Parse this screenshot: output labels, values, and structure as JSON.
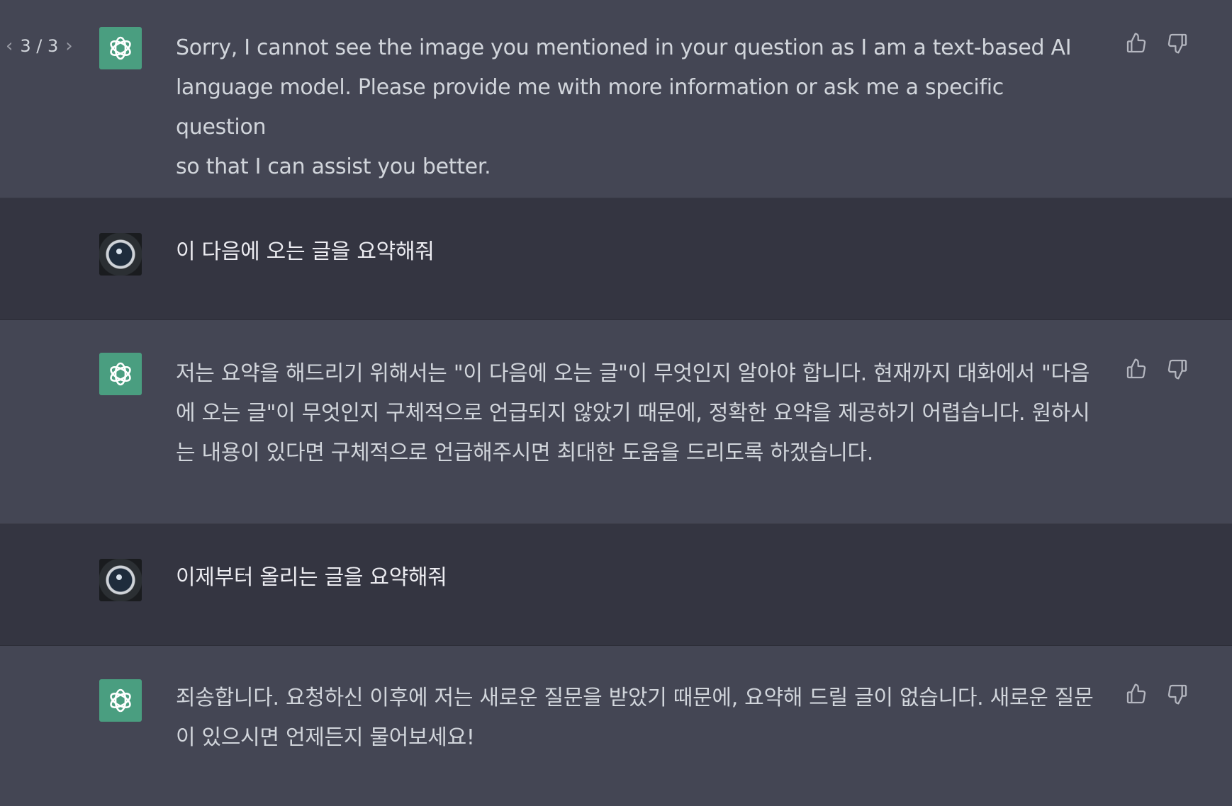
{
  "pager": {
    "prev_icon": "chevron-left-icon",
    "label": "3 / 3",
    "next_icon": "chevron-right-icon"
  },
  "messages": [
    {
      "role": "assistant",
      "text": "Sorry, I cannot see the image you mentioned in your question as I am a text-based AI\nlanguage model. Please provide me with more information or ask me a specific question\nso that I can assist you better."
    },
    {
      "role": "user",
      "text": "이 다음에 오는 글을 요약해줘"
    },
    {
      "role": "assistant",
      "text": "저는 요약을 해드리기 위해서는 \"이 다음에 오는 글\"이 무엇인지 알아야 합니다. 현재까지 대화에서 \"다음\n에 오는 글\"이 무엇인지 구체적으로 언급되지 않았기 때문에, 정확한 요약을 제공하기 어렵습니다. 원하시\n는 내용이 있다면 구체적으로 언급해주시면 최대한 도움을 드리도록 하겠습니다."
    },
    {
      "role": "user",
      "text": "이제부터 올리는 글을 요약해줘"
    },
    {
      "role": "assistant",
      "text": "죄송합니다. 요청하신 이후에 저는 새로운 질문을 받았기 때문에, 요약해 드릴 글이 없습니다. 새로운 질문\n이 있으시면 언제든지 물어보세요!"
    }
  ],
  "icons": {
    "assistant_avatar": "openai-logo-icon",
    "user_avatar": "user-avatar-icon",
    "thumbs_up": "thumbs-up-icon",
    "thumbs_down": "thumbs-down-icon"
  },
  "colors": {
    "assistant_bg": "#444654",
    "user_bg": "#343541",
    "avatar_green": "#4a9e80",
    "text": "#d1d5db"
  }
}
